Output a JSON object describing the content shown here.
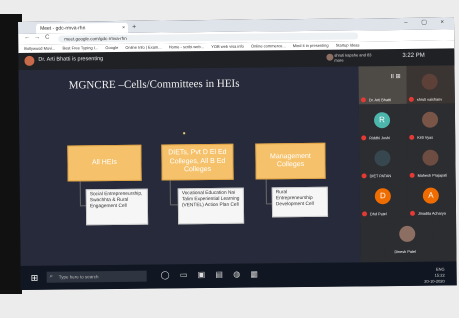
{
  "browser": {
    "tab_title": "Meet - gdc-rmva-rhn",
    "tab_close": "×",
    "new_tab": "+",
    "window_controls": "– ▢ ×",
    "url": "meet.google.com/gdc-rmva-rhn",
    "nav": {
      "back": "←",
      "forward": "→",
      "reload": "C"
    },
    "bookmarks": [
      "Bollywood Movi...",
      "Best Free Typing I...",
      "Google",
      "Online Info | Exam...",
      "Home - scribi.web...",
      "YOB web visa info",
      "Online commerce...",
      "Mind it in presenting",
      "Startup Ideas"
    ]
  },
  "meet": {
    "presenter_text": "Dr. Arti Bhatti is presenting",
    "participants_text": "shruti kapshe and 83 more",
    "time": "3:22 PM",
    "controls": "II ⊞"
  },
  "slide": {
    "title": "MGNCRE –Cells/Committees in HEIs",
    "boxes": [
      {
        "label": "All HEIs",
        "sub": "Social Entrepreneurship, Swachhta & Rural Engagement Cell"
      },
      {
        "label": "DIETs, Pvt D El Ed Colleges, All B Ed Colleges",
        "sub": "Vocational Education Nai Talim Experiential Learning (VENTEL) Action Plan Cell"
      },
      {
        "label": "Management Colleges",
        "sub": "Rural Entrepreneurship Development Cell"
      }
    ]
  },
  "participants": [
    {
      "name": "Dr. Arti Bhatti",
      "initial": "",
      "color": "#6d4c41"
    },
    {
      "name": "shruti vaishanv",
      "initial": "",
      "color": "#5d4037"
    },
    {
      "name": "Riddhi Joshi",
      "initial": "R",
      "color": "#4db6ac"
    },
    {
      "name": "Kirti Vyas",
      "initial": "",
      "color": "#795548"
    },
    {
      "name": "DIET PATAN",
      "initial": "",
      "color": "#37474f"
    },
    {
      "name": "Mahesh Prajapati",
      "initial": "",
      "color": "#6d4c41"
    },
    {
      "name": "Dhd Patel",
      "initial": "D",
      "color": "#ef6c00"
    },
    {
      "name": "Jinadita Acharya",
      "initial": "A",
      "color": "#ef6c00"
    },
    {
      "name": "Dinesh Patel",
      "initial": "",
      "color": "#8d6e63"
    }
  ],
  "taskbar": {
    "start": "⊞",
    "search_placeholder": "Type here to search",
    "icons": "◯ ▭ ▣ ▤ ◍ ▦",
    "tray": [
      "ENG",
      "15:22",
      "20-10-2020"
    ]
  }
}
